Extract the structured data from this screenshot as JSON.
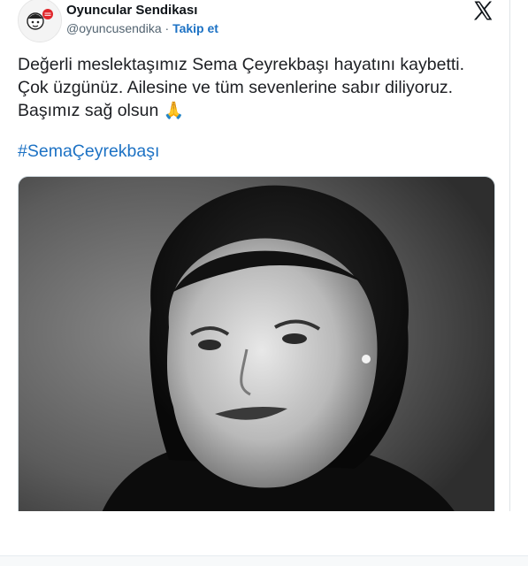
{
  "account": {
    "display_name": "Oyuncular Sendikası",
    "handle": "@oyuncusendika",
    "separator": "·",
    "follow_label": "Takip et"
  },
  "platform": {
    "logo_icon": "x-logo-icon"
  },
  "tweet": {
    "lines": [
      "Değerli meslektaşımız Sema Çeyrekbaşı hayatını kaybetti.",
      "Çok üzgünüz. Ailesine ve tüm sevenlerine sabır diliyoruz.",
      "Başımız sağ olsun"
    ],
    "emoji": "🙏",
    "hashtag": "#SemaÇeyrekbaşı"
  },
  "colors": {
    "link": "#1d72c4",
    "text": "#0f1419",
    "muted": "#536471"
  }
}
